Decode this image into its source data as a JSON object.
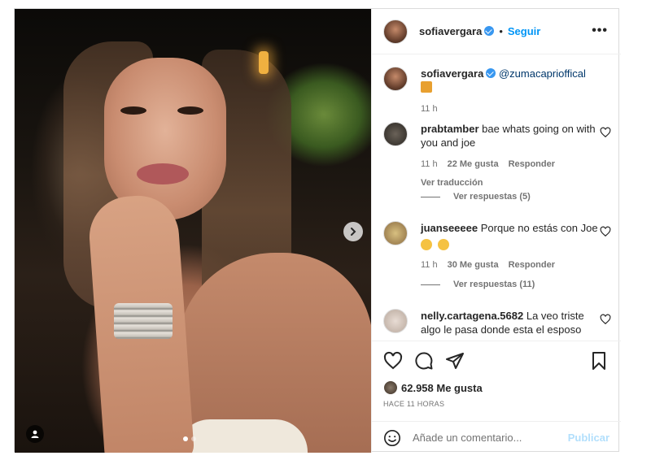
{
  "post": {
    "author": "sofiavergara",
    "follow_label": "Seguir",
    "more_label": "•••",
    "dot": "•"
  },
  "caption": {
    "author": "sofiavergara",
    "mention": "@zumacaprioffical",
    "time": "11 h"
  },
  "comments": [
    {
      "user": "prabtamber",
      "text": "bae whats going on with you and joe",
      "time": "11 h",
      "likes": "22 Me gusta",
      "reply": "Responder",
      "translate": "Ver traducción",
      "view_replies": "Ver respuestas (5)"
    },
    {
      "user": "juanseeeee",
      "text": "Porque no estás con Joe",
      "time": "11 h",
      "likes": "30 Me gusta",
      "reply": "Responder",
      "view_replies": "Ver respuestas (11)"
    },
    {
      "user": "nelly.cartagena.5682",
      "text": "La veo triste algo le pasa donde esta el esposo"
    }
  ],
  "stats": {
    "likes": "62.958 Me gusta",
    "time": "HACE 11 HORAS"
  },
  "composer": {
    "placeholder": "Añade un comentario...",
    "publish": "Publicar"
  },
  "colors": {
    "accent": "#0095f6",
    "verified": "#3897f0",
    "muted": "#737373"
  }
}
